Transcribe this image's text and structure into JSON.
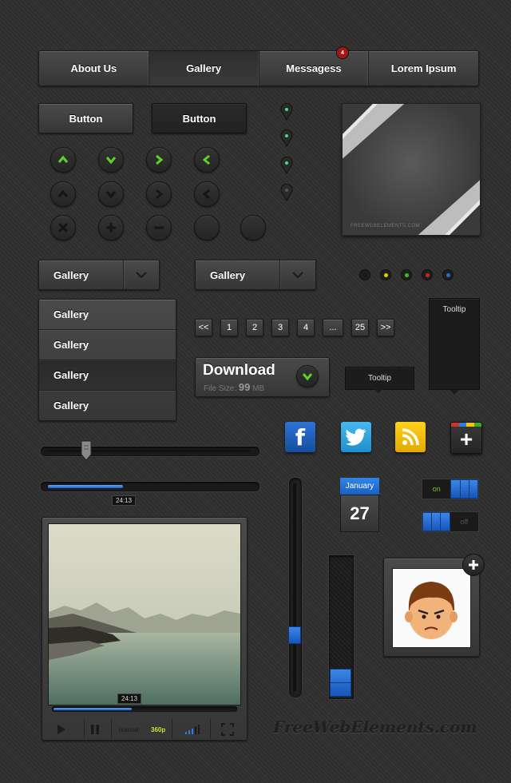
{
  "nav": {
    "items": [
      {
        "label": "About Us"
      },
      {
        "label": "Gallery"
      },
      {
        "label": "Messagess"
      },
      {
        "label": "Lorem Ipsum"
      }
    ],
    "active": "Gallery",
    "badge": "4"
  },
  "buttons": {
    "light": "Button",
    "dark": "Button"
  },
  "icon_buttons": {
    "row1": [
      "chevron-up-icon",
      "chevron-down-icon",
      "chevron-right-icon",
      "chevron-left-icon"
    ],
    "row2": [
      "chevron-up-icon",
      "chevron-down-icon",
      "chevron-right-icon",
      "chevron-left-icon"
    ],
    "row3": [
      "close-icon",
      "plus-icon",
      "minus-icon",
      "blank-icon",
      "blank-icon"
    ]
  },
  "photo_frame": {
    "watermark": "FREEWEBELEMENTS.COM"
  },
  "dropdowns": [
    {
      "value": "Gallery"
    },
    {
      "value": "Gallery"
    }
  ],
  "status_leds": [
    "#1a1a1a",
    "#e8c800",
    "#3bbf1a",
    "#d41f1f",
    "#2a6bd8"
  ],
  "menu": {
    "items": [
      {
        "label": "Gallery"
      },
      {
        "label": "Gallery"
      },
      {
        "label": "Gallery"
      },
      {
        "label": "Gallery"
      }
    ],
    "selected_index": 2
  },
  "pagination": [
    "<<",
    "1",
    "2",
    "3",
    "4",
    "...",
    "25",
    ">>"
  ],
  "download": {
    "title": "Download",
    "size_prefix": "File Size:",
    "size_value": "99",
    "size_unit": "MB"
  },
  "tooltips": {
    "horizontal": "Tooltip",
    "vertical": "Tooltip"
  },
  "social": [
    {
      "name": "facebook-icon",
      "glyph": "f",
      "color": "#1f5fb6"
    },
    {
      "name": "twitter-icon",
      "color": "#2aa6e0"
    },
    {
      "name": "rss-icon",
      "color": "#f2c200"
    },
    {
      "name": "google-plus-icon",
      "glyph": "+",
      "color": "#2d2d2d"
    }
  ],
  "slider": {
    "value": 0.19
  },
  "progress": {
    "value": 0.37,
    "time": "24:13"
  },
  "vertical_slider": {
    "value": 0.27
  },
  "vertical_level": {
    "value": 0.2
  },
  "calendar": {
    "month": "January",
    "day": "27"
  },
  "toggles": [
    {
      "label": "on",
      "state": "on"
    },
    {
      "label": "off",
      "state": "off"
    }
  ],
  "player": {
    "time": "24:13",
    "progress": 0.43,
    "mode": "normal",
    "quality": "360p"
  },
  "watermark": "FreeWebElements.com",
  "colors": {
    "accent_blue": "#2f7de0",
    "green": "#5ed12a"
  }
}
